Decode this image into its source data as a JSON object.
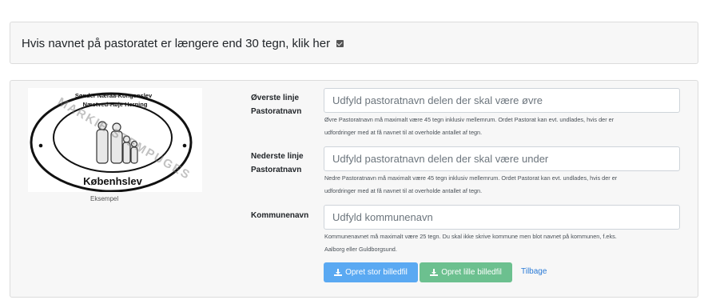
{
  "top_card": {
    "toggle_text": "Hvis navnet på pastoratet er længere end 30 tegn, klik her"
  },
  "logo": {
    "top_line_1": "Sønder Næraa-Kongenslev",
    "top_line_2": "Næstved-Høje Herning",
    "bottom_text": "Københslev",
    "watermark": "MARKIE STEMPUGES",
    "caption": "Eksempel"
  },
  "form": {
    "fields": [
      {
        "label_line1": "Øverste linje",
        "label_line2": "Pastoratnavn",
        "placeholder": "Udfyld pastoratnavn delen der skal være øvre",
        "help_line1": "Øvre Pastoratnavn må maximalt være 45 tegn inklusiv mellemrum. Ordet Pastorat kan evt. undlades, hvis der er",
        "help_line2": "udfordringer med at få navnet til at overholde antallet af tegn."
      },
      {
        "label_line1": "Nederste linje",
        "label_line2": "Pastoratnavn",
        "placeholder": "Udfyld pastoratnavn delen der skal være under",
        "help_line1": "Nedre Pastoratnavn må maximalt være 45 tegn inklusiv mellemrum. Ordet Pastorat kan evt. undlades, hvis der er",
        "help_line2": "udfordringer med at få navnet til at overholde antallet af tegn."
      },
      {
        "label_line1": "Kommunenavn",
        "placeholder": "Udfyld kommunenavn",
        "help_line1": "Kommunenavnet må maximalt være 25 tegn. Du skal ikke skrive kommune men blot navnet på kommunen, f.eks.",
        "help_line2": "Aalborg eller Guldborgsund."
      }
    ]
  },
  "buttons": {
    "large": "Opret stor billedfil",
    "small": "Opret lille billedfil",
    "back": "Tilbage"
  },
  "colors": {
    "primary": "#5aa9f2",
    "success": "#6cc08f",
    "link": "#2a7ad6"
  }
}
